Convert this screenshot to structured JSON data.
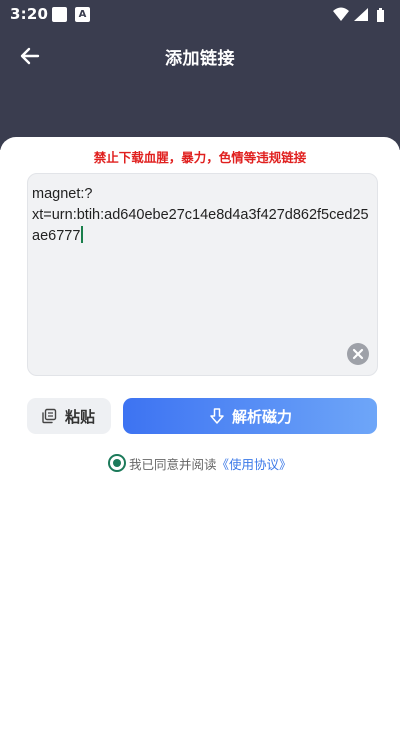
{
  "status_bar": {
    "time": "3:20",
    "notification_b": "A",
    "icons": [
      "wifi-icon",
      "signal-icon",
      "battery-icon"
    ]
  },
  "app_bar": {
    "title": "添加链接",
    "back_icon": "arrow-left-icon"
  },
  "warning": {
    "text": "禁止下载血腥，暴力，色情等违规链接",
    "color": "#e0201f"
  },
  "link_input": {
    "value": "magnet:?\nxt=urn:btih:ad640ebe27c14e8d4a3f427d862f5ced25ae6777",
    "clear_icon": "close-circle-icon"
  },
  "actions": {
    "paste_label": "粘贴",
    "paste_icon": "copy-icon",
    "parse_label": "解析磁力",
    "parse_icon": "download-arrow-icon"
  },
  "agreement": {
    "checked": true,
    "text": "我已同意并阅读",
    "link_text": "《使用协议》"
  },
  "colors": {
    "header_bg": "#3a3d4f",
    "accent_blue": "#3d73f2",
    "radio_green": "#1c7a5a",
    "link_blue": "#3a78e8"
  }
}
